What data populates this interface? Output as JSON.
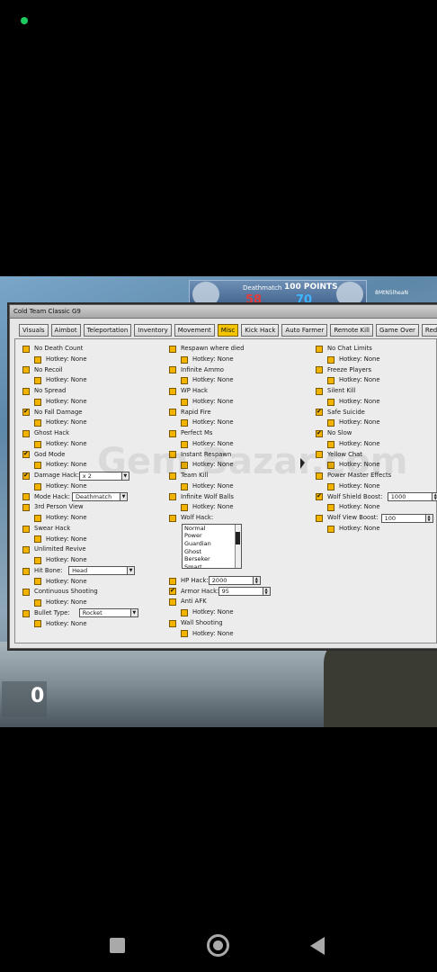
{
  "game": {
    "mode": "Deathmatch",
    "points": "100 POINTS",
    "score_red": "58",
    "score_blue": "70",
    "player": "8MtN5lheaN",
    "ammo": "0"
  },
  "window": {
    "title": "Cold Team Classic G9",
    "tabs": [
      "Visuals",
      "Aimbot",
      "Teleportation",
      "Inventory",
      "Movement",
      "Misc",
      "Kick Hack",
      "Auto Farmer",
      "Remote Kill",
      "Game Over",
      "Redeem"
    ],
    "active_tab": "Misc"
  },
  "columns": [
    [
      {
        "label": "No Death Count",
        "checked": false
      },
      {
        "label": "Hotkey: None",
        "sub": true
      },
      {
        "label": "No Recoil",
        "checked": false
      },
      {
        "label": "Hotkey: None",
        "sub": true
      },
      {
        "label": "No Spread",
        "checked": false
      },
      {
        "label": "Hotkey: None",
        "sub": true
      },
      {
        "label": "No Fall Damage",
        "checked": true
      },
      {
        "label": "Hotkey: None",
        "sub": true
      },
      {
        "label": "Ghost Hack",
        "checked": false
      },
      {
        "label": "Hotkey: None",
        "sub": true
      },
      {
        "label": "God Mode",
        "checked": true
      },
      {
        "label": "Hotkey: None",
        "sub": true
      },
      {
        "label": "Damage Hack:",
        "checked": true,
        "select": "x 2"
      },
      {
        "label": "Hotkey: None",
        "sub": true
      },
      {
        "label": "Mode Hack:",
        "checked": false,
        "select": "Deathmatch"
      },
      {
        "label": "3rd Person View",
        "checked": false
      },
      {
        "label": "Hotkey: None",
        "sub": true
      },
      {
        "label": "Swear Hack",
        "checked": false
      },
      {
        "label": "Hotkey: None",
        "sub": true
      },
      {
        "label": "Unlimited Revive",
        "checked": false
      },
      {
        "label": "Hotkey: None",
        "sub": true
      },
      {
        "label": "Hit Bone:",
        "checked": false,
        "select": "Head"
      },
      {
        "label": "Hotkey: None",
        "sub": true
      },
      {
        "label": "Continuous Shooting",
        "checked": false
      },
      {
        "label": "Hotkey: None",
        "sub": true
      },
      {
        "label": "Bullet Type:",
        "checked": false,
        "select": "Rocket"
      },
      {
        "label": "Hotkey: None",
        "sub": true
      }
    ],
    [
      {
        "label": "Respawn where died",
        "checked": false
      },
      {
        "label": "Hotkey: None",
        "sub": true
      },
      {
        "label": "Infinite Ammo",
        "checked": false
      },
      {
        "label": "Hotkey: None",
        "sub": true
      },
      {
        "label": "WP Hack",
        "checked": false
      },
      {
        "label": "Hotkey: None",
        "sub": true
      },
      {
        "label": "Rapid Fire",
        "checked": false
      },
      {
        "label": "Hotkey: None",
        "sub": true
      },
      {
        "label": "Perfect Ms",
        "checked": false
      },
      {
        "label": "Hotkey: None",
        "sub": true
      },
      {
        "label": "Instant Respawn",
        "checked": false
      },
      {
        "label": "Hotkey: None",
        "sub": true
      },
      {
        "label": "Team Kill",
        "checked": false
      },
      {
        "label": "Hotkey: None",
        "sub": true
      },
      {
        "label": "Infinite Wolf Balls",
        "checked": false
      },
      {
        "label": "Hotkey: None",
        "sub": true
      },
      {
        "label": "Wolf Hack:",
        "checked": false
      }
    ],
    [
      {
        "label": "No Chat Limits",
        "checked": false
      },
      {
        "label": "Hotkey: None",
        "sub": true
      },
      {
        "label": "Freeze Players",
        "checked": false
      },
      {
        "label": "Hotkey: None",
        "sub": true
      },
      {
        "label": "Silent Kill",
        "checked": false
      },
      {
        "label": "Hotkey: None",
        "sub": true
      },
      {
        "label": "Safe Suicide",
        "checked": true
      },
      {
        "label": "Hotkey: None",
        "sub": true
      },
      {
        "label": "No Slow",
        "checked": true
      },
      {
        "label": "Hotkey: None",
        "sub": true
      },
      {
        "label": "Yellow Chat",
        "checked": false
      },
      {
        "label": "Hotkey: None",
        "sub": true
      },
      {
        "label": "Power Master Effects",
        "checked": false
      },
      {
        "label": "Hotkey: None",
        "sub": true
      },
      {
        "label": "Wolf Shield Boost:",
        "checked": true,
        "spin": "1000"
      },
      {
        "label": "Hotkey: None",
        "sub": true
      },
      {
        "label": "Wolf View Boost:",
        "checked": false,
        "spin": "100"
      },
      {
        "label": "Hotkey: None",
        "sub": true
      }
    ]
  ],
  "wolf_list": [
    "Normal",
    "Power",
    "Guardian",
    "Ghost",
    "Berseker",
    "Smart"
  ],
  "column2_tail": [
    {
      "label": "HP Hack:",
      "checked": false,
      "spin": "2000"
    },
    {
      "label": "Armor Hack:",
      "checked": true,
      "spin": "95"
    },
    {
      "label": "Anti AFK",
      "checked": false
    },
    {
      "label": "Hotkey: None",
      "sub": true
    },
    {
      "label": "Wall Shooting",
      "checked": false
    },
    {
      "label": "Hotkey: None",
      "sub": true
    }
  ],
  "watermark": "Gem Bazar.com"
}
